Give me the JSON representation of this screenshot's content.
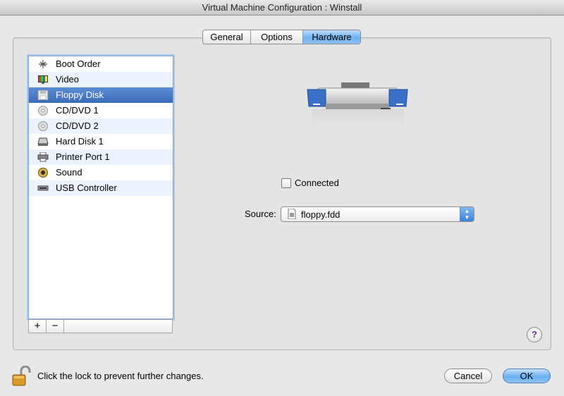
{
  "window": {
    "title": "Virtual Machine Configuration : Winstall"
  },
  "tabs": [
    {
      "label": "General",
      "active": false
    },
    {
      "label": "Options",
      "active": false
    },
    {
      "label": "Hardware",
      "active": true
    }
  ],
  "devices": [
    {
      "label": "Boot Order",
      "icon": "boot-order-icon"
    },
    {
      "label": "Video",
      "icon": "video-icon"
    },
    {
      "label": "Floppy Disk",
      "icon": "floppy-disk-icon",
      "selected": true
    },
    {
      "label": "CD/DVD 1",
      "icon": "cd-icon"
    },
    {
      "label": "CD/DVD 2",
      "icon": "cd-icon"
    },
    {
      "label": "Hard Disk 1",
      "icon": "hard-disk-icon"
    },
    {
      "label": "Printer Port 1",
      "icon": "printer-icon"
    },
    {
      "label": "Sound",
      "icon": "speaker-icon"
    },
    {
      "label": "USB Controller",
      "icon": "usb-icon"
    }
  ],
  "list_buttons": {
    "add": "+",
    "remove": "−"
  },
  "detail": {
    "connected_label": "Connected",
    "connected": false,
    "source_label": "Source:",
    "source_value": "floppy.fdd"
  },
  "help": {
    "label": "?"
  },
  "footer": {
    "lock_text": "Click the lock to prevent further changes.",
    "cancel_label": "Cancel",
    "ok_label": "OK"
  },
  "colors": {
    "selection": "#3b6cb8",
    "accent": "#6aaeef"
  }
}
